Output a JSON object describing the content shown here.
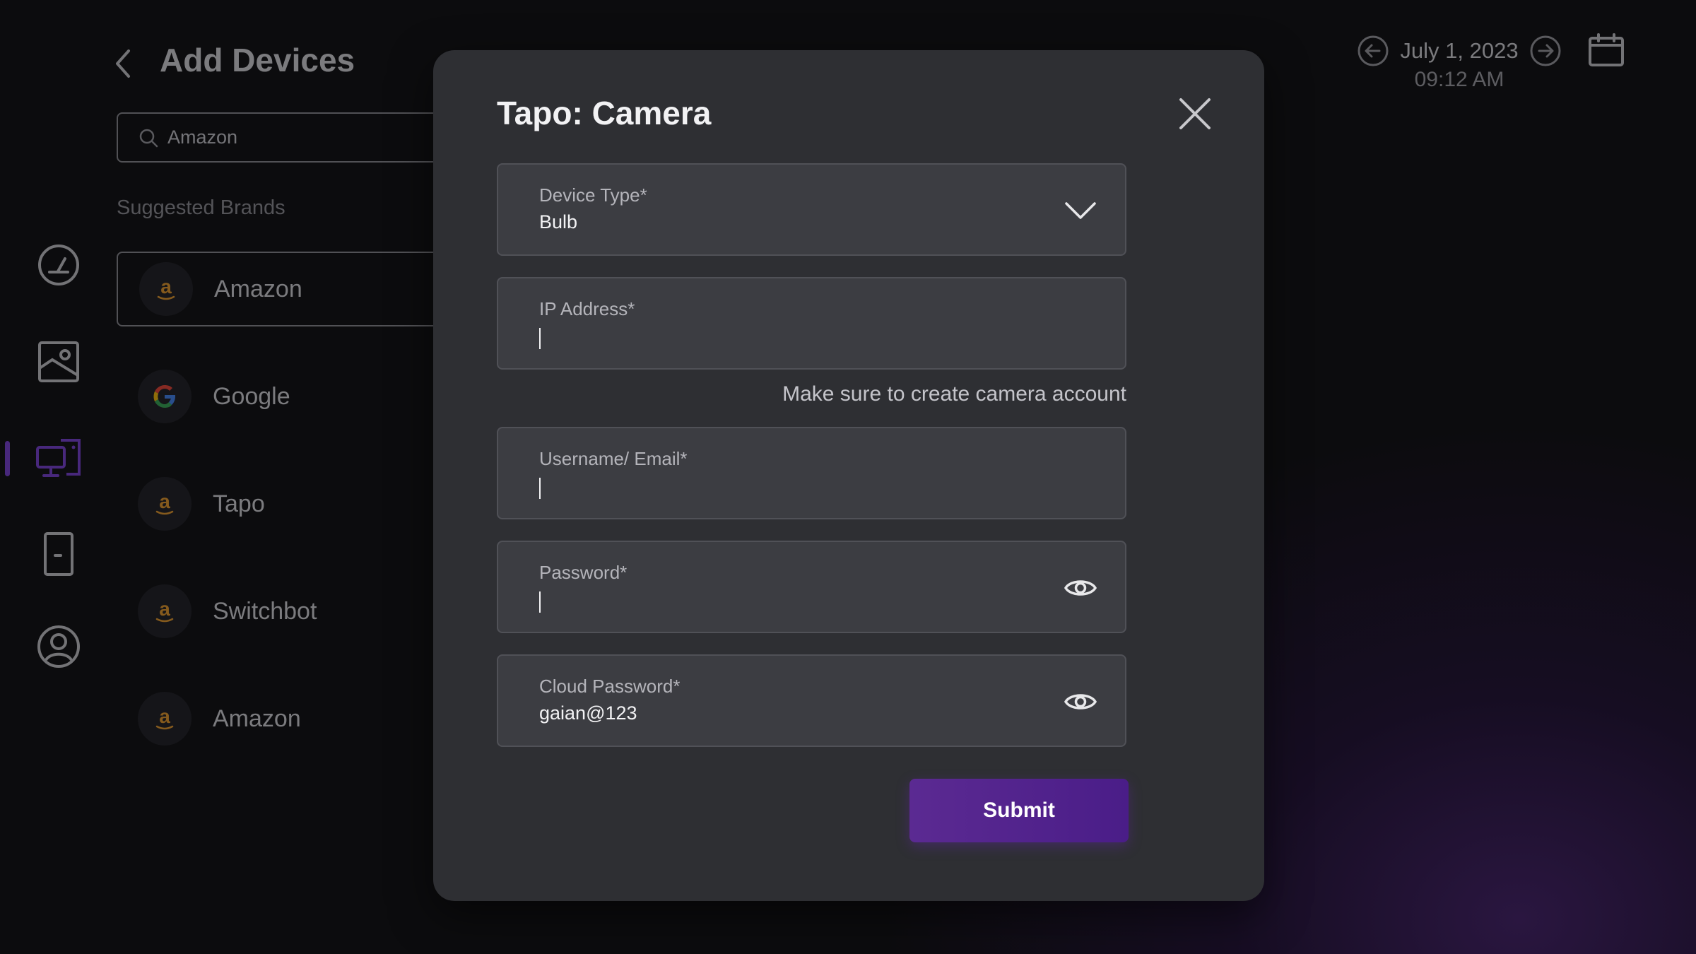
{
  "page": {
    "title": "Add Devices",
    "search": {
      "value": "Amazon"
    },
    "section_label": "Suggested Brands",
    "brands": [
      {
        "name": "Amazon",
        "logo": "amazon-logo",
        "selected": true
      },
      {
        "name": "Google",
        "logo": "google-logo",
        "selected": false
      },
      {
        "name": "Tapo",
        "logo": "amazon-logo",
        "selected": false
      },
      {
        "name": "Switchbot",
        "logo": "amazon-logo",
        "selected": false
      },
      {
        "name": "Amazon",
        "logo": "amazon-logo",
        "selected": false
      }
    ],
    "nav": [
      {
        "icon": "dashboard-gauge-icon",
        "active": false
      },
      {
        "icon": "gallery-icon",
        "active": false
      },
      {
        "icon": "devices-icon",
        "active": true
      },
      {
        "icon": "door-icon",
        "active": false
      },
      {
        "icon": "profile-icon",
        "active": false
      }
    ]
  },
  "header": {
    "date": "July 1, 2023",
    "time": "09:12 AM"
  },
  "modal": {
    "title": "Tapo: Camera",
    "device_type": {
      "label": "Device Type*",
      "value": "Bulb"
    },
    "ip_address": {
      "label": "IP Address*",
      "value": ""
    },
    "hint": "Make sure to create camera account",
    "username": {
      "label": "Username/ Email*",
      "value": ""
    },
    "password": {
      "label": "Password*",
      "value": ""
    },
    "cloud_password": {
      "label": "Cloud Password*",
      "value": "gaian@123"
    },
    "submit_label": "Submit"
  },
  "colors": {
    "accent": "#7a3fd6",
    "submit_start": "#5b2a92",
    "submit_end": "#4a1d88",
    "modal_bg": "#2e2f33",
    "field_bg": "#3c3d42",
    "amazon_orange": "#e89a2b"
  }
}
